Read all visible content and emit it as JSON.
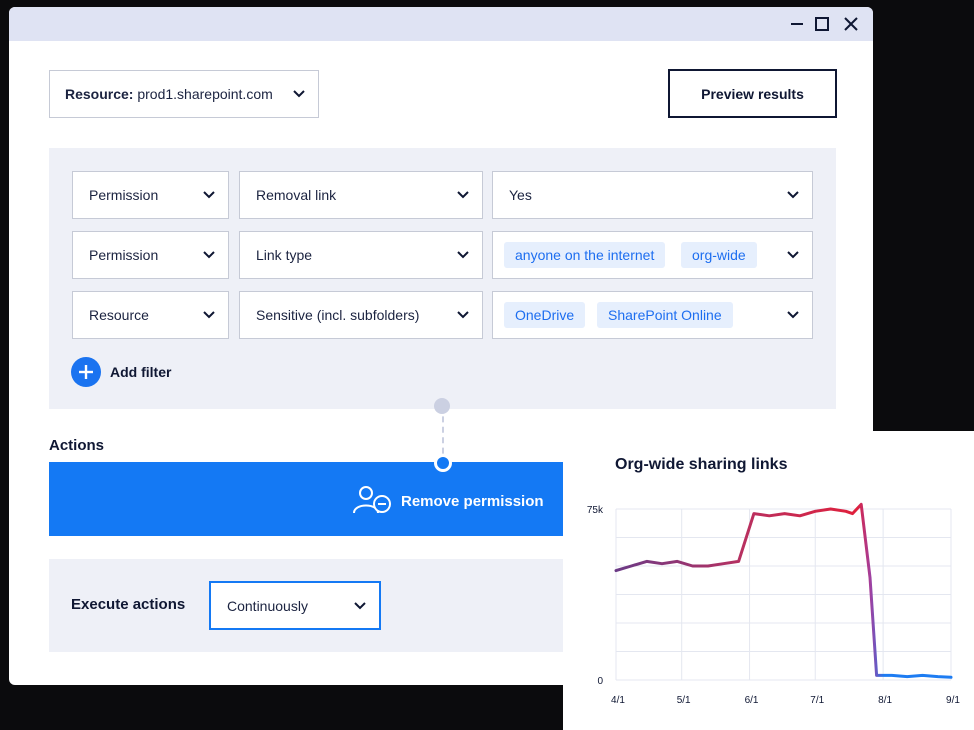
{
  "window": {
    "controls": [
      "minimize",
      "maximize",
      "close"
    ]
  },
  "resource_selector": {
    "prefix": "Resource:",
    "value": "prod1.sharepoint.com"
  },
  "preview_button": "Preview results",
  "filters": [
    {
      "field": "Permission",
      "attribute": "Removal link",
      "values": [],
      "text_value": "Yes"
    },
    {
      "field": "Permission",
      "attribute": "Link type",
      "values": [
        "anyone on the internet",
        "org-wide"
      ]
    },
    {
      "field": "Resource",
      "attribute": "Sensitive (incl. subfolders)",
      "values": [
        "OneDrive",
        "SharePoint Online"
      ]
    }
  ],
  "add_filter_label": "Add filter",
  "actions": {
    "title": "Actions",
    "action_label": "Remove permission"
  },
  "execute": {
    "label": "Execute actions",
    "value": "Continuously"
  },
  "colors": {
    "accent": "#1479f4",
    "title_bar": "#dfe3f3",
    "panel": "#eef0f7",
    "line_high": "#e0203c",
    "line_low": "#1d7cf2"
  },
  "chart_data": {
    "type": "line",
    "title": "Org-wide sharing links",
    "y_ticks": [
      "75k",
      "0"
    ],
    "x_ticks": [
      "4/1",
      "5/1",
      "6/1",
      "7/1",
      "8/1",
      "9/1"
    ],
    "ylim": [
      0,
      75000
    ],
    "grid": true,
    "series": [
      {
        "x": [
          "4/1",
          "4/8",
          "4/15",
          "4/22",
          "4/29",
          "5/6",
          "5/13",
          "5/20",
          "5/27",
          "6/3",
          "6/10",
          "6/17",
          "6/24",
          "7/1",
          "7/8",
          "7/15",
          "7/18",
          "7/22",
          "7/26",
          "7/29",
          "8/5",
          "8/12",
          "8/19",
          "8/26",
          "9/1"
        ],
        "values": [
          48000,
          50000,
          52000,
          51000,
          52000,
          50000,
          50000,
          51000,
          52000,
          73000,
          72000,
          73000,
          72000,
          74000,
          75000,
          74000,
          73000,
          77000,
          45000,
          2000,
          2000,
          1500,
          2000,
          1500,
          1200
        ]
      }
    ]
  }
}
